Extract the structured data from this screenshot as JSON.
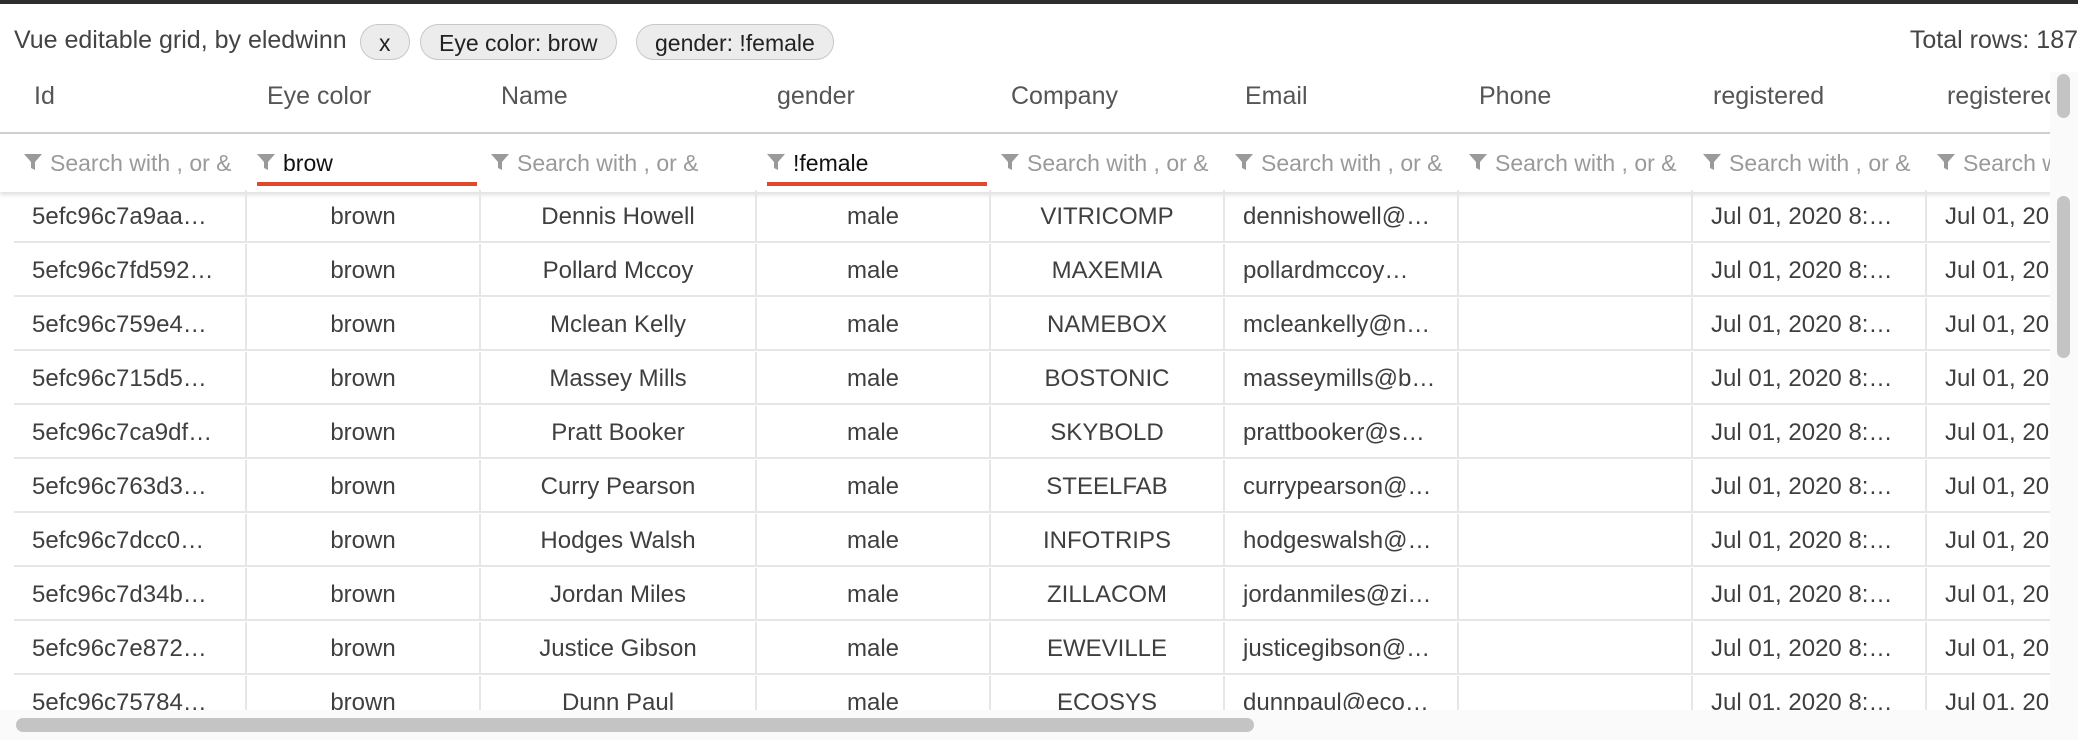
{
  "header": {
    "title": "Vue editable grid, by eledwinn",
    "chips": [
      "x",
      "Eye color: brow",
      "gender: !female"
    ],
    "total": "Total rows: 187"
  },
  "columns": [
    "Id",
    "Eye color",
    "Name",
    "gender",
    "Company",
    "Email",
    "Phone",
    "registered",
    "registered"
  ],
  "filters": [
    {
      "value": "",
      "placeholder": "Search with , or &"
    },
    {
      "value": "brow",
      "placeholder": "Search with , or &"
    },
    {
      "value": "",
      "placeholder": "Search with , or &"
    },
    {
      "value": "!female",
      "placeholder": "Search with , or &"
    },
    {
      "value": "",
      "placeholder": "Search with , or &"
    },
    {
      "value": "",
      "placeholder": "Search with , or &"
    },
    {
      "value": "",
      "placeholder": "Search with , or &"
    },
    {
      "value": "",
      "placeholder": "Search with , or &"
    },
    {
      "value": "",
      "placeholder": "Search with , or &"
    }
  ],
  "rows": [
    [
      "5efc96c7a9aa…",
      "brown",
      "Dennis Howell",
      "male",
      "VITRICOMP",
      "dennishowell@…",
      "",
      "Jul 01, 2020 8:…",
      "Jul 01, 20"
    ],
    [
      "5efc96c7fd592…",
      "brown",
      "Pollard Mccoy",
      "male",
      "MAXEMIA",
      "pollardmccoy…",
      "",
      "Jul 01, 2020 8:…",
      "Jul 01, 20"
    ],
    [
      "5efc96c759e4…",
      "brown",
      "Mclean Kelly",
      "male",
      "NAMEBOX",
      "mcleankelly@n…",
      "",
      "Jul 01, 2020 8:…",
      "Jul 01, 20"
    ],
    [
      "5efc96c715d5…",
      "brown",
      "Massey Mills",
      "male",
      "BOSTONIC",
      "masseymills@b…",
      "",
      "Jul 01, 2020 8:…",
      "Jul 01, 20"
    ],
    [
      "5efc96c7ca9df…",
      "brown",
      "Pratt Booker",
      "male",
      "SKYBOLD",
      "prattbooker@s…",
      "",
      "Jul 01, 2020 8:…",
      "Jul 01, 20"
    ],
    [
      "5efc96c763d3…",
      "brown",
      "Curry Pearson",
      "male",
      "STEELFAB",
      "currypearson@…",
      "",
      "Jul 01, 2020 8:…",
      "Jul 01, 20"
    ],
    [
      "5efc96c7dcc0…",
      "brown",
      "Hodges Walsh",
      "male",
      "INFOTRIPS",
      "hodgeswalsh@…",
      "",
      "Jul 01, 2020 8:…",
      "Jul 01, 20"
    ],
    [
      "5efc96c7d34b…",
      "brown",
      "Jordan Miles",
      "male",
      "ZILLACOM",
      "jordanmiles@zi…",
      "",
      "Jul 01, 2020 8:…",
      "Jul 01, 20"
    ],
    [
      "5efc96c7e872…",
      "brown",
      "Justice Gibson",
      "male",
      "EWEVILLE",
      "justicegibson@…",
      "",
      "Jul 01, 2020 8:…",
      "Jul 01, 20"
    ],
    [
      "5efc96c75784…",
      "brown",
      "Dunn Paul",
      "male",
      "ECOSYS",
      "dunnpaul@eco…",
      "",
      "Jul 01, 2020 8:…",
      "Jul 01, 20"
    ]
  ],
  "colors": {
    "accent": "#e0472f",
    "border": "#e6e6e6"
  }
}
